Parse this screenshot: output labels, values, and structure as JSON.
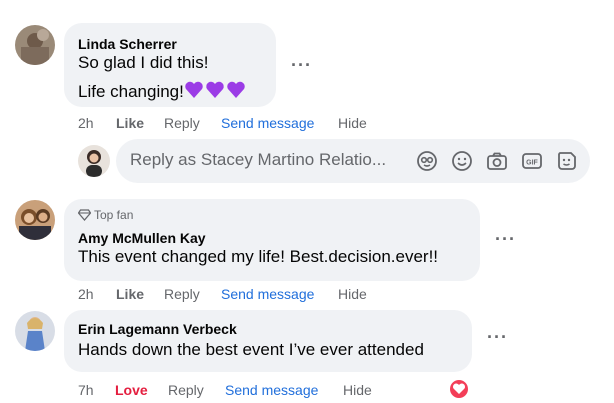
{
  "comments": [
    {
      "author": "Linda Scherrer",
      "line1": "So glad I did this!",
      "line2": "Life changing!",
      "emoji": "purple-heart-icon",
      "time": "2h",
      "like": "Like",
      "reply": "Reply",
      "send_message": "Send message",
      "hide": "Hide"
    },
    {
      "badge": "Top fan",
      "author": "Amy McMullen Kay",
      "text": "This event changed my life! Best.decision.ever!!",
      "time": "2h",
      "like": "Like",
      "reply": "Reply",
      "send_message": "Send message",
      "hide": "Hide"
    },
    {
      "author": "Erin Lagemann Verbeck",
      "text": "Hands down the best event I’ve ever attended",
      "time": "7h",
      "reaction": "Love",
      "reply": "Reply",
      "send_message": "Send message",
      "hide": "Hide",
      "reaction_icon": "heart-icon"
    }
  ],
  "reply_box": {
    "placeholder": "Reply as Stacey Martino Relatio...",
    "icons": [
      "avatar-frame-icon",
      "smiley-icon",
      "camera-icon",
      "gif-icon",
      "sticker-icon"
    ]
  },
  "colors": {
    "bubble": "#f0f2f5",
    "link_blue": "#216fdb",
    "love_red": "#e41e3f",
    "heart_purple": "#9b3ce6",
    "meta_gray": "#65676b"
  },
  "more_label": "···"
}
